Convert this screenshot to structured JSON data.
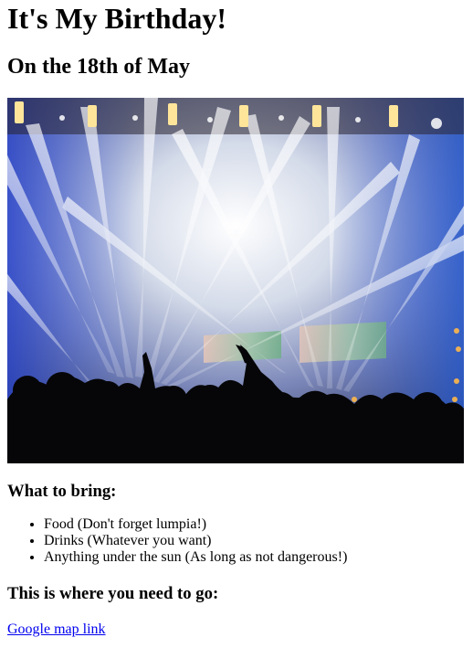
{
  "page": {
    "title": "It's My Birthday!",
    "subtitle": "On the 18th of May",
    "hero_image_icon": "concert-crowd-lights-image"
  },
  "bring_section": {
    "heading": "What to bring:",
    "items": [
      "Food (Don't forget lumpia!)",
      "Drinks (Whatever you want)",
      "Anything under the sun (As long as not dangerous!)"
    ]
  },
  "location_section": {
    "heading": "This is where you need to go:",
    "link_text": "Google map link"
  },
  "colors": {
    "link": "#0000ee",
    "text": "#000000",
    "background": "#ffffff"
  }
}
